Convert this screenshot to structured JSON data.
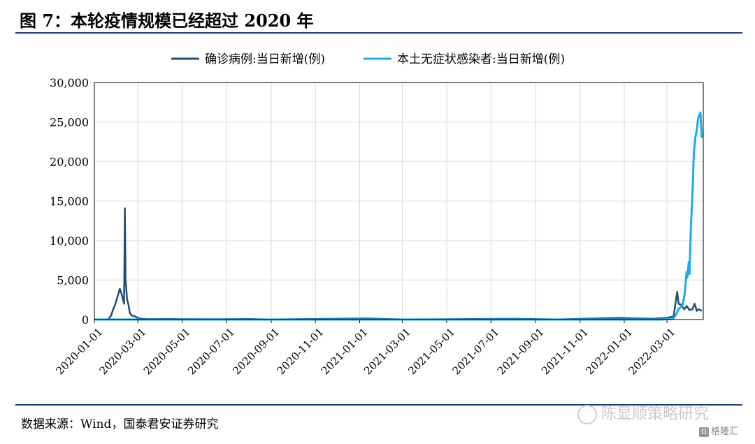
{
  "header": {
    "title": "图 7：本轮疫情规模已经超过 2020 年"
  },
  "footer": {
    "source": "数据来源：Wind，国泰君安证券研究"
  },
  "watermark": {
    "text": "陈显顺策略研究",
    "brand": "格隆汇",
    "brand_icon": "G"
  },
  "colors": {
    "series1": "#1f4e79",
    "series2": "#1aace6",
    "grid": "#d9d9d9",
    "rule": "#1f3f77"
  },
  "chart_data": {
    "type": "line",
    "title": "",
    "xlabel": "",
    "ylabel": "",
    "ylim": [
      0,
      30000
    ],
    "xlim": [
      "2020-01-01",
      "2022-04-20"
    ],
    "yticks": [
      0,
      5000,
      10000,
      15000,
      20000,
      25000,
      30000
    ],
    "ytick_labels": [
      "0",
      "5,000",
      "10,000",
      "15,000",
      "20,000",
      "25,000",
      "30,000"
    ],
    "xtick_labels": [
      "2020-01-01",
      "2020-03-01",
      "2020-05-01",
      "2020-07-01",
      "2020-09-01",
      "2020-11-01",
      "2021-01-01",
      "2021-03-01",
      "2021-05-01",
      "2021-07-01",
      "2021-09-01",
      "2021-11-01",
      "2022-01-01",
      "2022-03-01"
    ],
    "grid": true,
    "legend_position": "top",
    "series": [
      {
        "name": "确诊病例:当日新增(例)",
        "points": [
          [
            "2020-01-01",
            0
          ],
          [
            "2020-01-18",
            0
          ],
          [
            "2020-01-21",
            100
          ],
          [
            "2020-01-24",
            500
          ],
          [
            "2020-01-27",
            1300
          ],
          [
            "2020-01-30",
            2000
          ],
          [
            "2020-02-01",
            2600
          ],
          [
            "2020-02-03",
            3200
          ],
          [
            "2020-02-05",
            3900
          ],
          [
            "2020-02-07",
            3400
          ],
          [
            "2020-02-09",
            2700
          ],
          [
            "2020-02-11",
            2000
          ],
          [
            "2020-02-12",
            14100
          ],
          [
            "2020-02-13",
            5100
          ],
          [
            "2020-02-15",
            2600
          ],
          [
            "2020-02-17",
            1900
          ],
          [
            "2020-02-19",
            800
          ],
          [
            "2020-02-22",
            500
          ],
          [
            "2020-02-26",
            400
          ],
          [
            "2020-03-01",
            200
          ],
          [
            "2020-03-06",
            100
          ],
          [
            "2020-03-15",
            50
          ],
          [
            "2020-04-15",
            60
          ],
          [
            "2020-06-20",
            40
          ],
          [
            "2020-08-01",
            60
          ],
          [
            "2020-09-01",
            20
          ],
          [
            "2021-01-10",
            130
          ],
          [
            "2021-01-20",
            110
          ],
          [
            "2021-03-01",
            20
          ],
          [
            "2021-08-01",
            100
          ],
          [
            "2021-10-01",
            30
          ],
          [
            "2021-12-25",
            200
          ],
          [
            "2022-01-10",
            150
          ],
          [
            "2022-02-10",
            100
          ],
          [
            "2022-03-01",
            200
          ],
          [
            "2022-03-10",
            400
          ],
          [
            "2022-03-15",
            3500
          ],
          [
            "2022-03-17",
            2000
          ],
          [
            "2022-03-20",
            1900
          ],
          [
            "2022-03-25",
            1300
          ],
          [
            "2022-03-28",
            1700
          ],
          [
            "2022-04-01",
            1200
          ],
          [
            "2022-04-05",
            1300
          ],
          [
            "2022-04-08",
            2000
          ],
          [
            "2022-04-11",
            1100
          ],
          [
            "2022-04-14",
            1300
          ],
          [
            "2022-04-18",
            1100
          ]
        ]
      },
      {
        "name": "本土无症状感染者:当日新增(例)",
        "points": [
          [
            "2020-01-01",
            0
          ],
          [
            "2022-02-20",
            0
          ],
          [
            "2022-03-05",
            50
          ],
          [
            "2022-03-10",
            150
          ],
          [
            "2022-03-14",
            700
          ],
          [
            "2022-03-16",
            1200
          ],
          [
            "2022-03-19",
            1500
          ],
          [
            "2022-03-22",
            1700
          ],
          [
            "2022-03-25",
            3000
          ],
          [
            "2022-03-28",
            6000
          ],
          [
            "2022-03-29",
            5300
          ],
          [
            "2022-03-31",
            7300
          ],
          [
            "2022-04-01",
            5800
          ],
          [
            "2022-04-03",
            12000
          ],
          [
            "2022-04-05",
            15500
          ],
          [
            "2022-04-07",
            21000
          ],
          [
            "2022-04-09",
            23000
          ],
          [
            "2022-04-11",
            24000
          ],
          [
            "2022-04-13",
            25500
          ],
          [
            "2022-04-16",
            26200
          ],
          [
            "2022-04-18",
            23000
          ]
        ]
      }
    ]
  }
}
